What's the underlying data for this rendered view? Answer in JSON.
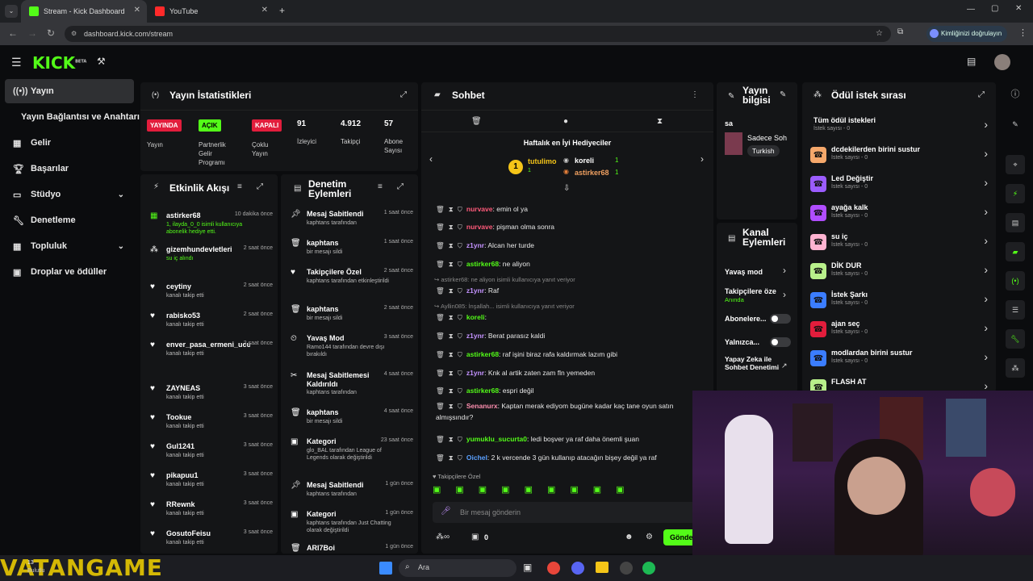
{
  "browser": {
    "tabs": [
      {
        "title": "Stream - Kick Dashboard"
      },
      {
        "title": "YouTube"
      }
    ],
    "url": "dashboard.kick.com/stream",
    "profile_label": "Kimliğinizi doğrulayın"
  },
  "app": {
    "logo": "KICK",
    "logo_sup": "BETA"
  },
  "sidebar": {
    "items": [
      {
        "label": "Yayın",
        "icon": "broadcast-icon"
      },
      {
        "label": "Yayın Bağlantısı ve Anahtarı"
      },
      {
        "label": "Gelir",
        "icon": "revenue-icon"
      },
      {
        "label": "Başarılar",
        "icon": "trophy-icon"
      },
      {
        "label": "Stüdyo",
        "icon": "studio-icon"
      },
      {
        "label": "Denetleme",
        "icon": "wrench-icon"
      },
      {
        "label": "Topluluk",
        "icon": "community-icon"
      },
      {
        "label": "Droplar ve ödüller",
        "icon": "gift-icon"
      }
    ]
  },
  "stats": {
    "title": "Yayın İstatistikleri",
    "status": {
      "badge": "YAYINDA",
      "label": "Yayın"
    },
    "partner": {
      "badge": "AÇIK",
      "label": "Partnerlik Gelir Programı"
    },
    "multi": {
      "badge": "KAPALI",
      "label": "Çoklu Yayın"
    },
    "viewers": {
      "value": "91",
      "label": "İzleyici"
    },
    "followers": {
      "value": "4.912",
      "label": "Takipçi"
    },
    "subs": {
      "value": "57",
      "label": "Abone Sayısı"
    },
    "colors": {
      "live": "#e21d3c",
      "on": "#53fc18",
      "off": "#e21d3c"
    }
  },
  "feed": {
    "title": "Etkinlik Akışı",
    "items": [
      {
        "name": "astirker68",
        "time": "10 dakika önce",
        "desc": "1, ilayda_0_0 isimli kullanıcıya abonelik hediye etti.",
        "green": true
      },
      {
        "name": "gizemhundevletleri",
        "time": "2 saat önce",
        "desc": "su iç alındı",
        "green": false
      },
      {
        "name": "ceytiny",
        "time": "2 saat önce",
        "desc": "kanalı takip etti"
      },
      {
        "name": "rabisko53",
        "time": "2 saat önce",
        "desc": "kanalı takip etti"
      },
      {
        "name": "enver_pasa_ermeni_ucuran",
        "time": "2 saat önce",
        "desc": "kanalı takip etti"
      },
      {
        "name": "ZAYNEAS",
        "time": "3 saat önce",
        "desc": "kanalı takip etti"
      },
      {
        "name": "Tookue",
        "time": "3 saat önce",
        "desc": "kanalı takip etti"
      },
      {
        "name": "Gul1241",
        "time": "3 saat önce",
        "desc": "kanalı takip etti"
      },
      {
        "name": "pikapuu1",
        "time": "3 saat önce",
        "desc": "kanalı takip etti"
      },
      {
        "name": "RRewnk",
        "time": "3 saat önce",
        "desc": "kanalı takip etti"
      },
      {
        "name": "GosutoFeisu",
        "time": "3 saat önce",
        "desc": "kanalı takip etti"
      }
    ]
  },
  "moderation": {
    "title": "Denetim Eylemleri",
    "items": [
      {
        "name": "Mesaj Sabitlendi",
        "time": "1 saat önce",
        "desc": "kaphtans tarafından"
      },
      {
        "name": "kaphtans",
        "time": "1 saat önce",
        "desc": "bir mesajı sildi"
      },
      {
        "name": "Takipçilere Özel",
        "time": "2 saat önce",
        "desc": "kaphtans tarafından etkinleştirildi"
      },
      {
        "name": "kaphtans",
        "time": "2 saat önce",
        "desc": "bir mesajı sildi"
      },
      {
        "name": "Yavaş Mod",
        "time": "3 saat önce",
        "desc": "Ramo144 tarafından devre dışı bırakıldı"
      },
      {
        "name": "Mesaj Sabitlemesi Kaldırıldı",
        "time": "4 saat önce",
        "desc": "kaphtans tarafından"
      },
      {
        "name": "kaphtans",
        "time": "4 saat önce",
        "desc": "bir mesajı sildi"
      },
      {
        "name": "Kategori",
        "time": "23 saat önce",
        "desc": "glo_BAL tarafından League of Legends olarak değiştirildi"
      },
      {
        "name": "Mesaj Sabitlendi",
        "time": "1 gün önce",
        "desc": "kaphtans tarafından"
      },
      {
        "name": "Kategori",
        "time": "1 gün önce",
        "desc": "kaphtans tarafından Just Chatting olarak değiştirildi"
      },
      {
        "name": "ARI7Boi",
        "time": "1 gün önce",
        "desc": ""
      }
    ]
  },
  "chat": {
    "title": "Sohbet",
    "gifters_title": "Haftalık en İyi Hediyeciler",
    "gifters": [
      {
        "name": "tutulimo",
        "count": "1"
      },
      {
        "name": "koreli",
        "count": "1"
      },
      {
        "name": "astirker68",
        "count": "1"
      }
    ],
    "messages": [
      {
        "user": "nurvave",
        "text": "emin ol ya",
        "color": "#ff5a7a"
      },
      {
        "user": "nurvave",
        "text": "pişman olma sonra",
        "color": "#ff5a7a"
      },
      {
        "user": "z1ynr",
        "text": "Alcan her turde",
        "color": "#c493ff"
      },
      {
        "user": "astirker68",
        "text": "ne aliyon",
        "color": "#53fc18"
      },
      {
        "user": "z1ynr",
        "text": "Raf",
        "color": "#c493ff",
        "reply": "astirker68: ne aliyon isimli kullanıcıya yanıt veriyor"
      },
      {
        "user": "koreli",
        "text": "",
        "color": "#53fc18",
        "reply": "Ayllin085: İnşallah... isimli kullanıcıya yanıt veriyor"
      },
      {
        "user": "z1ynr",
        "text": "Berat parasız kaldi",
        "color": "#c493ff"
      },
      {
        "user": "astirker68",
        "text": "raf işini biraz rafa kaldırmak lazım gibi",
        "color": "#53fc18"
      },
      {
        "user": "z1ynr",
        "text": "Knk al artik zaten zam fln yemeden",
        "color": "#c493ff"
      },
      {
        "user": "astirker68",
        "text": "espri değil",
        "color": "#53fc18"
      },
      {
        "user": "Senanurx",
        "text": "Kaptan merak ediyom bugüne kadar kaç tane oyun satın almışsındır?",
        "color": "#ff8fb0"
      },
      {
        "user": "yumuklu_sucurta0",
        "text": "ledi boşver ya raf daha önemli şuan",
        "color": "#53fc18"
      },
      {
        "user": "Oichel",
        "text": "2 k vercende 3 gün kullanıp atacağın bişey değil ya raf",
        "color": "#5aa0ff"
      }
    ],
    "followers_only": "Takipçilere Özel",
    "input_placeholder": "Bir mesaj gönderin",
    "send_label": "Gönder",
    "count": "0"
  },
  "info": {
    "title": "Yayın bilgisi",
    "stream_title": "sa",
    "mode": "Sadece Soh",
    "lang": "Turkish"
  },
  "actions": {
    "title": "Kanal Eylemleri",
    "items": [
      {
        "label": "Yavaş mod"
      },
      {
        "label": "Takipçilere öze",
        "sub": "Anında"
      },
      {
        "label": "Abonelere..."
      },
      {
        "label": "Yalnızca..."
      },
      {
        "label": "Yapay Zeka ile Sohbet Denetimi"
      }
    ]
  },
  "rewards": {
    "title": "Ödül istek sırası",
    "all": {
      "name": "Tüm ödül istekleri",
      "count": "İstek sayısı - 0"
    },
    "items": [
      {
        "name": "dcdekilerden birini sustur",
        "count": "İstek sayısı - 0",
        "color": "#f5a86b"
      },
      {
        "name": "Led Değiştir",
        "count": "İstek sayısı - 0",
        "color": "#9b5cff"
      },
      {
        "name": "ayağa kalk",
        "count": "İstek sayısı - 0",
        "color": "#b04dff"
      },
      {
        "name": "su iç",
        "count": "İstek sayısı - 0",
        "color": "#ffb3d1"
      },
      {
        "name": "DİK DUR",
        "count": "İstek sayısı - 0",
        "color": "#b8f08a"
      },
      {
        "name": "İstek Şarkı",
        "count": "İstek sayısı - 0",
        "color": "#3b7dff"
      },
      {
        "name": "ajan seç",
        "count": "İstek sayısı - 0",
        "color": "#e21d3c"
      },
      {
        "name": "modlardan birini sustur",
        "count": "İstek sayısı - 0",
        "color": "#3b7dff"
      },
      {
        "name": "FLASH AT",
        "count": "",
        "color": "#b8f08a"
      }
    ]
  },
  "taskbar": {
    "search": "Ara",
    "weather": "13",
    "weather_sub": "Bulutlu"
  },
  "watermark": "VATANGAME"
}
